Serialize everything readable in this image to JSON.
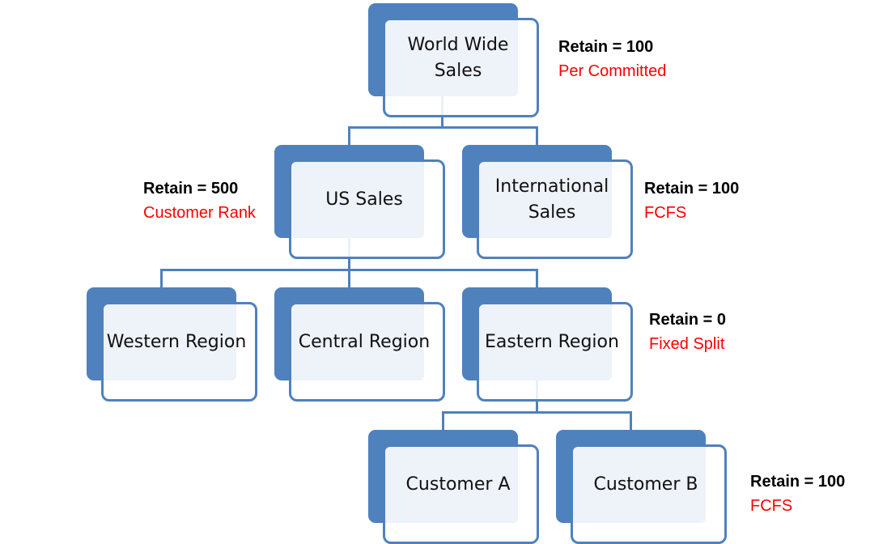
{
  "nodes": {
    "world": "World Wide Sales",
    "us": "US Sales",
    "intl": "International Sales",
    "western": "Western Region",
    "central": "Central Region",
    "eastern": "Eastern Region",
    "custA": "Customer A",
    "custB": "Customer B"
  },
  "annotations": {
    "world": {
      "retain": "Retain = 100",
      "method": "Per Committed"
    },
    "us": {
      "retain": "Retain = 500",
      "method": "Customer Rank"
    },
    "intl": {
      "retain": "Retain = 100",
      "method": "FCFS"
    },
    "eastern": {
      "retain": "Retain = 0",
      "method": "Fixed Split"
    },
    "custB": {
      "retain": "Retain = 100",
      "method": "FCFS"
    }
  },
  "colors": {
    "node": "#4f81bd",
    "method": "#ff0000"
  }
}
